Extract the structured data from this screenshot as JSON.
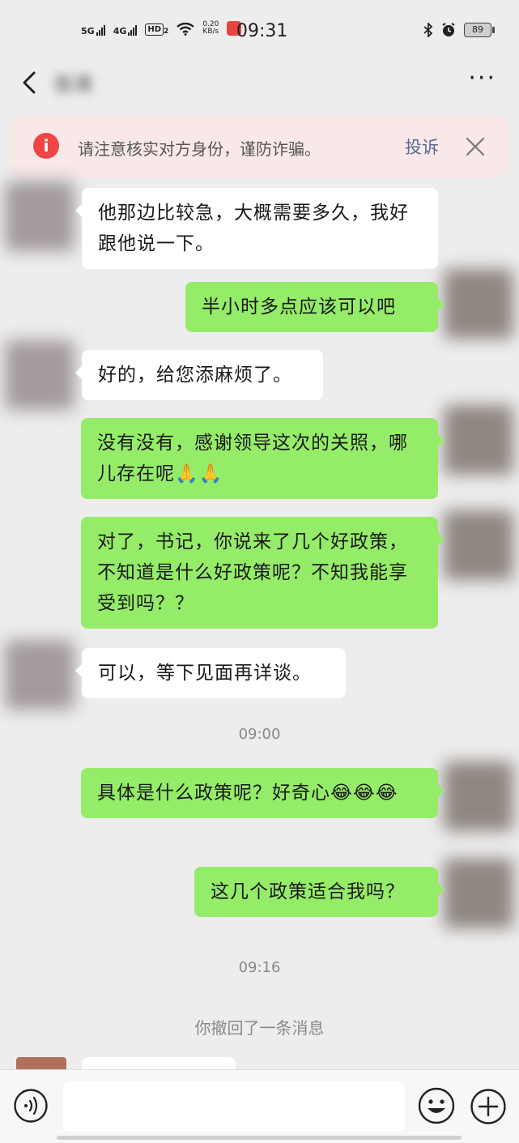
{
  "status_bar": {
    "net1": "5G",
    "net2": "4G",
    "hd": "HD",
    "hd_sub": "2",
    "speed_value": "0.20",
    "speed_unit": "KB/s",
    "time": "09:31",
    "battery": "89"
  },
  "navbar": {
    "title": "张涛",
    "more": "···"
  },
  "warning": {
    "text": "请注意核实对方身份，谨防诈骗。",
    "complain": "投诉"
  },
  "messages": [
    {
      "side": "in",
      "text": "他那边比较急，大概需要多久，我好跟他说一下。"
    },
    {
      "side": "out",
      "text": "半小时多点应该可以吧"
    },
    {
      "side": "in",
      "text": "好的，给您添麻烦了。"
    },
    {
      "side": "out",
      "text": "没有没有，感谢领导这次的关照，哪儿存在呢🙏🙏"
    },
    {
      "side": "out",
      "text": "对了，书记，你说来了几个好政策，不知道是什么好政策呢？不知我能享受到吗？？"
    },
    {
      "side": "in",
      "text": "可以，等下见面再详谈。"
    },
    {
      "side": "out",
      "text": "具体是什么政策呢？好奇心😂😂😂"
    },
    {
      "side": "out",
      "text": "这几个政策适合我吗？"
    }
  ],
  "timestamps": [
    "09:00",
    "09:16"
  ],
  "revoke_notice": "你撤回了一条消息",
  "input": {
    "placeholder": ""
  },
  "icons": {
    "back": "chevron-left-icon",
    "voice": "voice-icon",
    "emoji": "emoji-icon",
    "plus": "plus-icon"
  },
  "colors": {
    "background": "#ededed",
    "outgoing_bubble": "#95ec69",
    "incoming_bubble": "#ffffff",
    "warning_bg": "#f8e8e8",
    "warning_icon": "#f04545",
    "link": "#576b95"
  }
}
